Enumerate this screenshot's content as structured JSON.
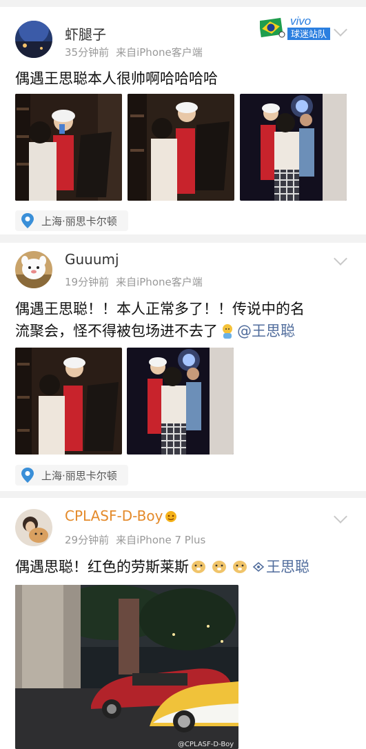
{
  "brand": {
    "vivo_text": "vivo",
    "subtitle": "球迷站队"
  },
  "posts": [
    {
      "username": "虾腿子",
      "time": "35分钟前",
      "source": "来自iPhone客户端",
      "text": "偶遇王思聪本人很帅啊哈哈哈哈",
      "location": "上海·丽思卡尔顿"
    },
    {
      "username": "Guuumj",
      "time": "19分钟前",
      "source": "来自iPhone客户端",
      "text_line1": "偶遇王思聪！！本人正常多了！！传说中的名",
      "text_line2": "流聚会，怪不得被包场进不去了",
      "mention": "@王思聪",
      "location": "上海·丽思卡尔顿"
    },
    {
      "username": "CPLASF-D-Boy",
      "time": "29分钟前",
      "source": "来自iPhone 7 Plus",
      "text": "偶遇思聪！红色的劳斯莱斯",
      "mention": "王思聪",
      "watermark": "@CPLASF-D-Boy"
    }
  ],
  "colors": {
    "accent_blue": "#506c9c",
    "meta_gray": "#999999",
    "pin_blue": "#3a8fd8"
  }
}
